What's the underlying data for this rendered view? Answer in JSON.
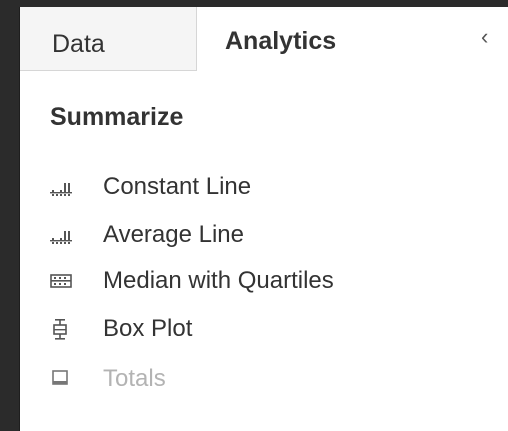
{
  "tabs": {
    "data_label": "Data",
    "analytics_label": "Analytics",
    "active": "Analytics",
    "collapse_glyph": "‹"
  },
  "summarize": {
    "title": "Summarize",
    "items": [
      {
        "label": "Constant Line",
        "icon": "constant-line-icon",
        "enabled": true
      },
      {
        "label": "Average Line",
        "icon": "average-line-icon",
        "enabled": true
      },
      {
        "label": "Median with Quartiles",
        "icon": "median-quartiles-icon",
        "enabled": true
      },
      {
        "label": "Box Plot",
        "icon": "box-plot-icon",
        "enabled": true
      },
      {
        "label": "Totals",
        "icon": "totals-icon",
        "enabled": false
      }
    ]
  },
  "colors": {
    "text": "#333333",
    "disabled_text": "#b3b3b3",
    "frame": "#2b2b2b"
  }
}
